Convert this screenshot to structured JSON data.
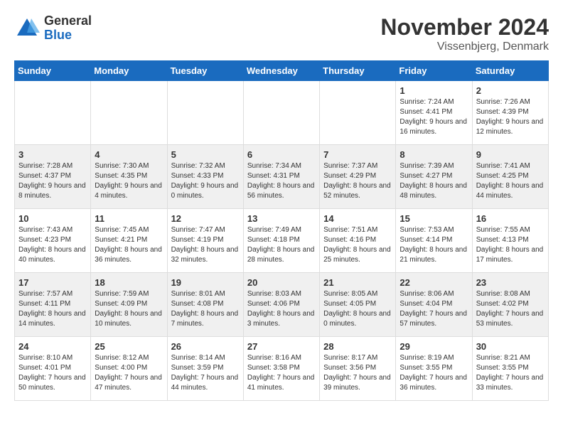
{
  "logo": {
    "general": "General",
    "blue": "Blue"
  },
  "title": "November 2024",
  "location": "Vissenbjerg, Denmark",
  "days_of_week": [
    "Sunday",
    "Monday",
    "Tuesday",
    "Wednesday",
    "Thursday",
    "Friday",
    "Saturday"
  ],
  "weeks": [
    [
      {
        "day": "",
        "info": ""
      },
      {
        "day": "",
        "info": ""
      },
      {
        "day": "",
        "info": ""
      },
      {
        "day": "",
        "info": ""
      },
      {
        "day": "",
        "info": ""
      },
      {
        "day": "1",
        "info": "Sunrise: 7:24 AM\nSunset: 4:41 PM\nDaylight: 9 hours and 16 minutes."
      },
      {
        "day": "2",
        "info": "Sunrise: 7:26 AM\nSunset: 4:39 PM\nDaylight: 9 hours and 12 minutes."
      }
    ],
    [
      {
        "day": "3",
        "info": "Sunrise: 7:28 AM\nSunset: 4:37 PM\nDaylight: 9 hours and 8 minutes."
      },
      {
        "day": "4",
        "info": "Sunrise: 7:30 AM\nSunset: 4:35 PM\nDaylight: 9 hours and 4 minutes."
      },
      {
        "day": "5",
        "info": "Sunrise: 7:32 AM\nSunset: 4:33 PM\nDaylight: 9 hours and 0 minutes."
      },
      {
        "day": "6",
        "info": "Sunrise: 7:34 AM\nSunset: 4:31 PM\nDaylight: 8 hours and 56 minutes."
      },
      {
        "day": "7",
        "info": "Sunrise: 7:37 AM\nSunset: 4:29 PM\nDaylight: 8 hours and 52 minutes."
      },
      {
        "day": "8",
        "info": "Sunrise: 7:39 AM\nSunset: 4:27 PM\nDaylight: 8 hours and 48 minutes."
      },
      {
        "day": "9",
        "info": "Sunrise: 7:41 AM\nSunset: 4:25 PM\nDaylight: 8 hours and 44 minutes."
      }
    ],
    [
      {
        "day": "10",
        "info": "Sunrise: 7:43 AM\nSunset: 4:23 PM\nDaylight: 8 hours and 40 minutes."
      },
      {
        "day": "11",
        "info": "Sunrise: 7:45 AM\nSunset: 4:21 PM\nDaylight: 8 hours and 36 minutes."
      },
      {
        "day": "12",
        "info": "Sunrise: 7:47 AM\nSunset: 4:19 PM\nDaylight: 8 hours and 32 minutes."
      },
      {
        "day": "13",
        "info": "Sunrise: 7:49 AM\nSunset: 4:18 PM\nDaylight: 8 hours and 28 minutes."
      },
      {
        "day": "14",
        "info": "Sunrise: 7:51 AM\nSunset: 4:16 PM\nDaylight: 8 hours and 25 minutes."
      },
      {
        "day": "15",
        "info": "Sunrise: 7:53 AM\nSunset: 4:14 PM\nDaylight: 8 hours and 21 minutes."
      },
      {
        "day": "16",
        "info": "Sunrise: 7:55 AM\nSunset: 4:13 PM\nDaylight: 8 hours and 17 minutes."
      }
    ],
    [
      {
        "day": "17",
        "info": "Sunrise: 7:57 AM\nSunset: 4:11 PM\nDaylight: 8 hours and 14 minutes."
      },
      {
        "day": "18",
        "info": "Sunrise: 7:59 AM\nSunset: 4:09 PM\nDaylight: 8 hours and 10 minutes."
      },
      {
        "day": "19",
        "info": "Sunrise: 8:01 AM\nSunset: 4:08 PM\nDaylight: 8 hours and 7 minutes."
      },
      {
        "day": "20",
        "info": "Sunrise: 8:03 AM\nSunset: 4:06 PM\nDaylight: 8 hours and 3 minutes."
      },
      {
        "day": "21",
        "info": "Sunrise: 8:05 AM\nSunset: 4:05 PM\nDaylight: 8 hours and 0 minutes."
      },
      {
        "day": "22",
        "info": "Sunrise: 8:06 AM\nSunset: 4:04 PM\nDaylight: 7 hours and 57 minutes."
      },
      {
        "day": "23",
        "info": "Sunrise: 8:08 AM\nSunset: 4:02 PM\nDaylight: 7 hours and 53 minutes."
      }
    ],
    [
      {
        "day": "24",
        "info": "Sunrise: 8:10 AM\nSunset: 4:01 PM\nDaylight: 7 hours and 50 minutes."
      },
      {
        "day": "25",
        "info": "Sunrise: 8:12 AM\nSunset: 4:00 PM\nDaylight: 7 hours and 47 minutes."
      },
      {
        "day": "26",
        "info": "Sunrise: 8:14 AM\nSunset: 3:59 PM\nDaylight: 7 hours and 44 minutes."
      },
      {
        "day": "27",
        "info": "Sunrise: 8:16 AM\nSunset: 3:58 PM\nDaylight: 7 hours and 41 minutes."
      },
      {
        "day": "28",
        "info": "Sunrise: 8:17 AM\nSunset: 3:56 PM\nDaylight: 7 hours and 39 minutes."
      },
      {
        "day": "29",
        "info": "Sunrise: 8:19 AM\nSunset: 3:55 PM\nDaylight: 7 hours and 36 minutes."
      },
      {
        "day": "30",
        "info": "Sunrise: 8:21 AM\nSunset: 3:55 PM\nDaylight: 7 hours and 33 minutes."
      }
    ]
  ]
}
